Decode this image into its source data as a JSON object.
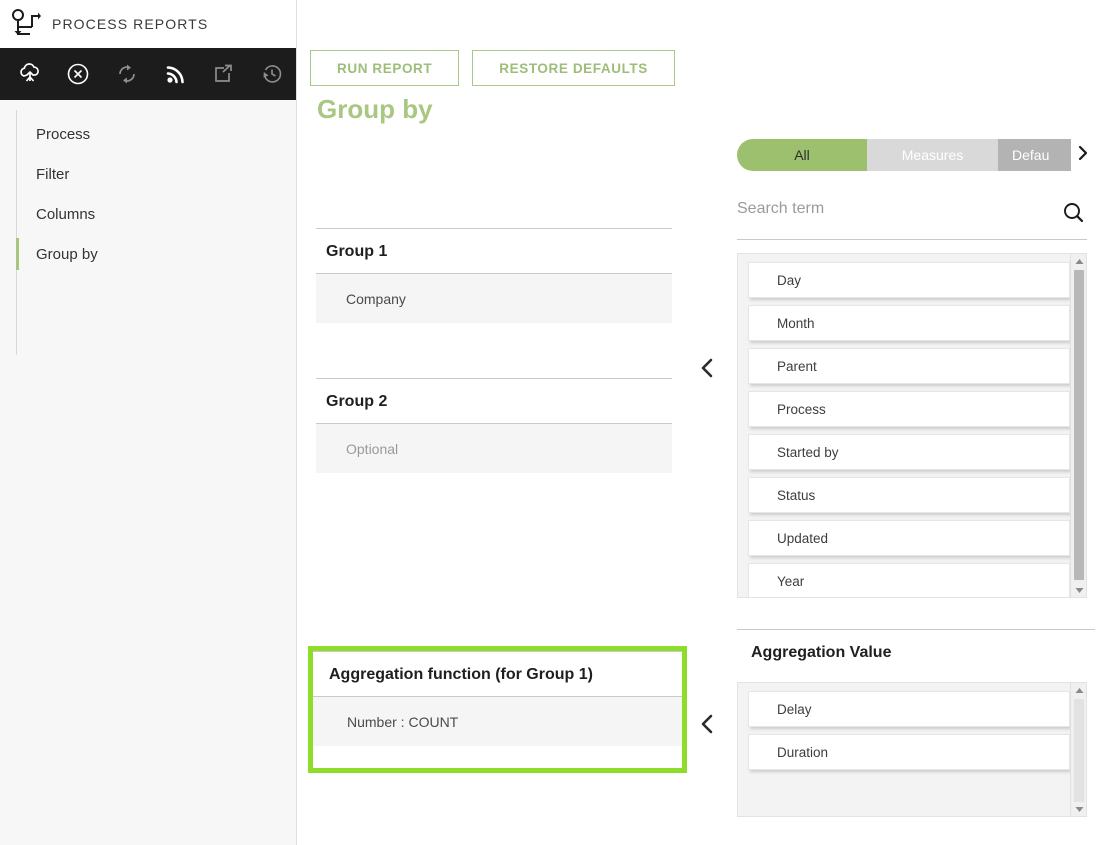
{
  "brand": {
    "title": "PROCESS REPORTS",
    "icon": "process-diagram-icon"
  },
  "toolbar": {
    "items": [
      {
        "name": "cloud-tree-icon",
        "label": "Cloud"
      },
      {
        "name": "close-circle-icon",
        "label": "Close"
      },
      {
        "name": "refresh-icon",
        "label": "Refresh"
      },
      {
        "name": "rss-feed-icon",
        "label": "Feed"
      },
      {
        "name": "export-icon",
        "label": "Export"
      },
      {
        "name": "history-icon",
        "label": "History"
      }
    ]
  },
  "sidebar": {
    "items": [
      {
        "label": "Process",
        "active": false
      },
      {
        "label": "Filter",
        "active": false
      },
      {
        "label": "Columns",
        "active": false
      },
      {
        "label": "Group by",
        "active": true
      }
    ]
  },
  "actions": {
    "run_report": "RUN REPORT",
    "restore_defaults": "RESTORE DEFAULTS"
  },
  "page": {
    "title": "Group by"
  },
  "groups": [
    {
      "heading": "Group 1",
      "value": "Company",
      "is_placeholder": false
    },
    {
      "heading": "Group 2",
      "value": "Optional",
      "is_placeholder": true
    }
  ],
  "aggregation_function": {
    "heading": "Aggregation function (for Group 1)",
    "value": "Number : COUNT",
    "highlight_color": "#8ddd2a"
  },
  "tabs": {
    "items": [
      {
        "label": "All",
        "selected": true
      },
      {
        "label": "Measures",
        "selected": false
      },
      {
        "label": "Defau",
        "selected": false
      }
    ],
    "next_icon": "chevron-right-icon",
    "selected_color": "#9dc06f"
  },
  "search": {
    "placeholder": "Search term",
    "value": "",
    "icon": "search-icon"
  },
  "attribute_list": {
    "items": [
      "Day",
      "Month",
      "Parent",
      "Process",
      "Started by",
      "Status",
      "Updated",
      "Year"
    ]
  },
  "aggregation_value": {
    "heading": "Aggregation Value",
    "items": [
      "Delay",
      "Duration"
    ]
  },
  "collapse_controls": [
    {
      "name": "collapse-groups-arrow",
      "icon": "chevron-left-icon"
    },
    {
      "name": "collapse-aggregation-arrow",
      "icon": "chevron-left-icon"
    }
  ]
}
